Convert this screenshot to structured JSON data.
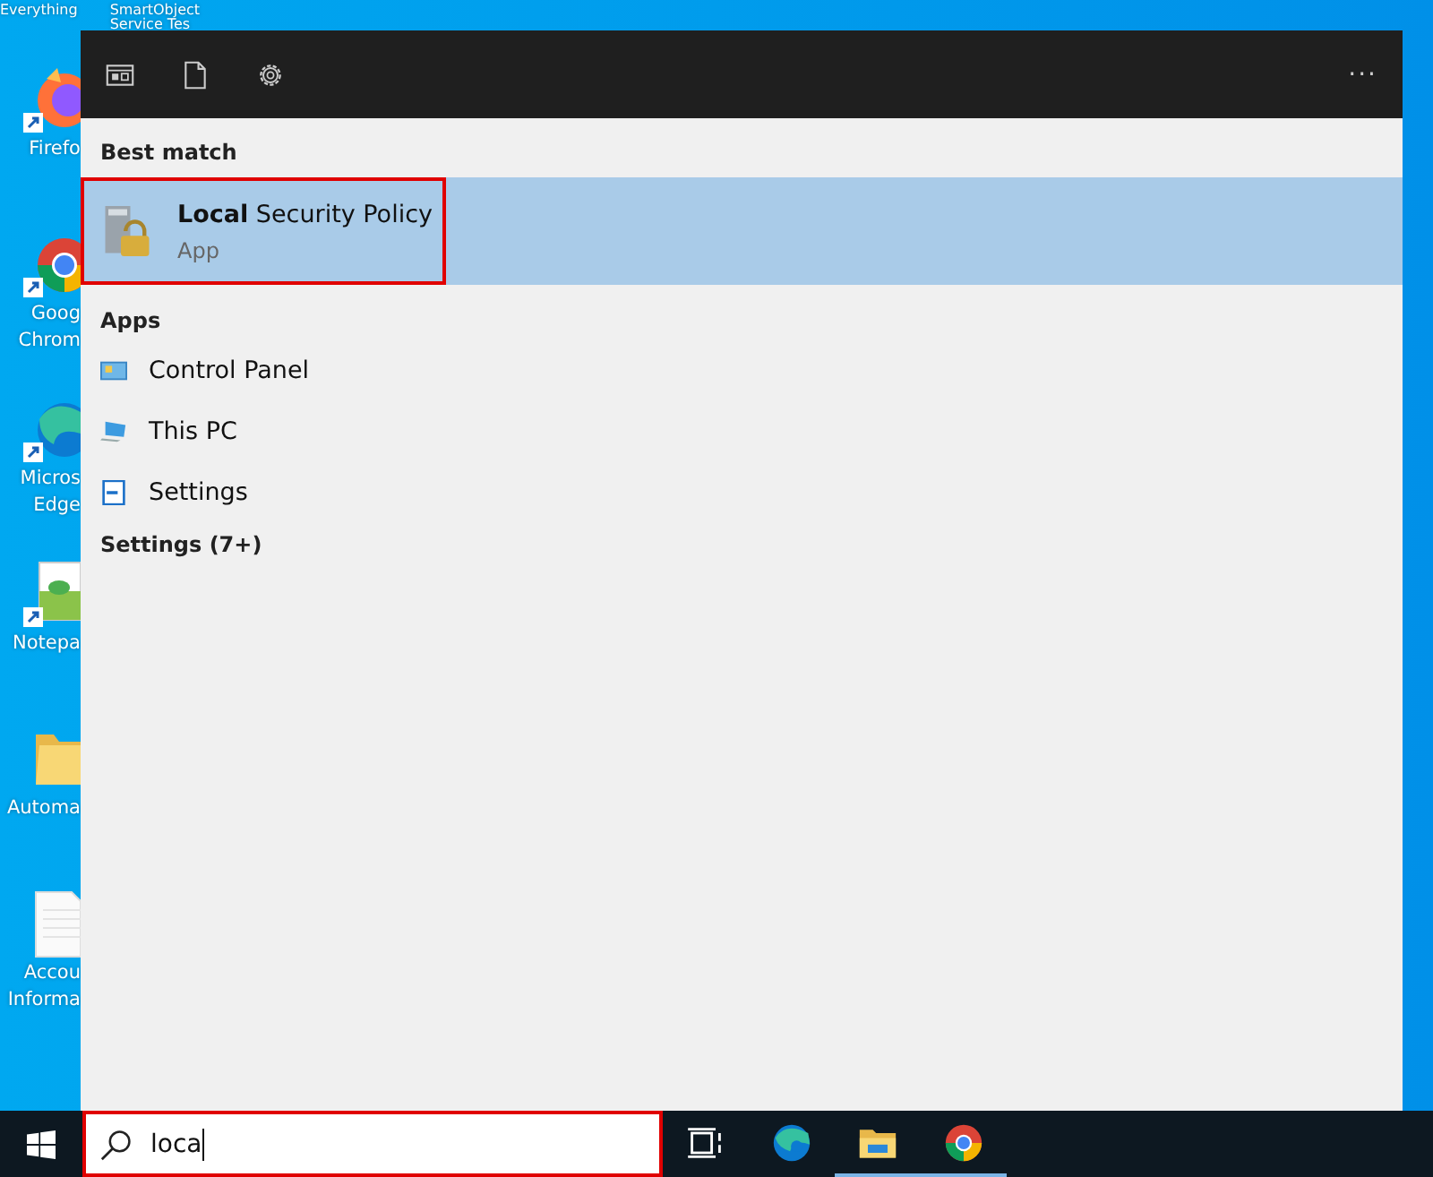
{
  "desktop": {
    "top_labels": [
      "Everything",
      "SmartObject Service Tes"
    ],
    "icons": [
      {
        "kind": "firefox",
        "label": "Firefo",
        "shortcut": true
      },
      {
        "kind": "chrome",
        "label": "Goog Chrom",
        "shortcut": true
      },
      {
        "kind": "edge",
        "label": "Micros Edge",
        "shortcut": true
      },
      {
        "kind": "notepad",
        "label": "Notepa",
        "shortcut": true
      },
      {
        "kind": "folder",
        "label": "Automa",
        "shortcut": false
      },
      {
        "kind": "document",
        "label": "Accou Informa",
        "shortcut": false
      }
    ]
  },
  "search_panel": {
    "header_icons": [
      {
        "kind": "apps"
      },
      {
        "kind": "documents"
      },
      {
        "kind": "settings"
      }
    ],
    "more": "···",
    "sections": [
      {
        "heading": "Best match",
        "items": [
          {
            "kind": "security",
            "title": "**Local** Security Policy",
            "subtitle": "App",
            "selected": true
          }
        ]
      },
      {
        "heading": "Apps",
        "items": [
          {
            "kind": "control",
            "title": "Control Panel",
            "selected": false
          },
          {
            "kind": "pc",
            "title": "This PC",
            "selected": false
          },
          {
            "kind": "settings",
            "title": "Settings",
            "selected": false
          }
        ]
      },
      {
        "heading": "Settings (7+)"
      }
    ]
  },
  "taskbar": {
    "search": {
      "value": "loca"
    },
    "apps": [
      {
        "kind": "taskview",
        "running": false
      },
      {
        "kind": "edge",
        "running": false
      },
      {
        "kind": "explorer",
        "running": true
      },
      {
        "kind": "chrome",
        "running": true
      }
    ]
  }
}
